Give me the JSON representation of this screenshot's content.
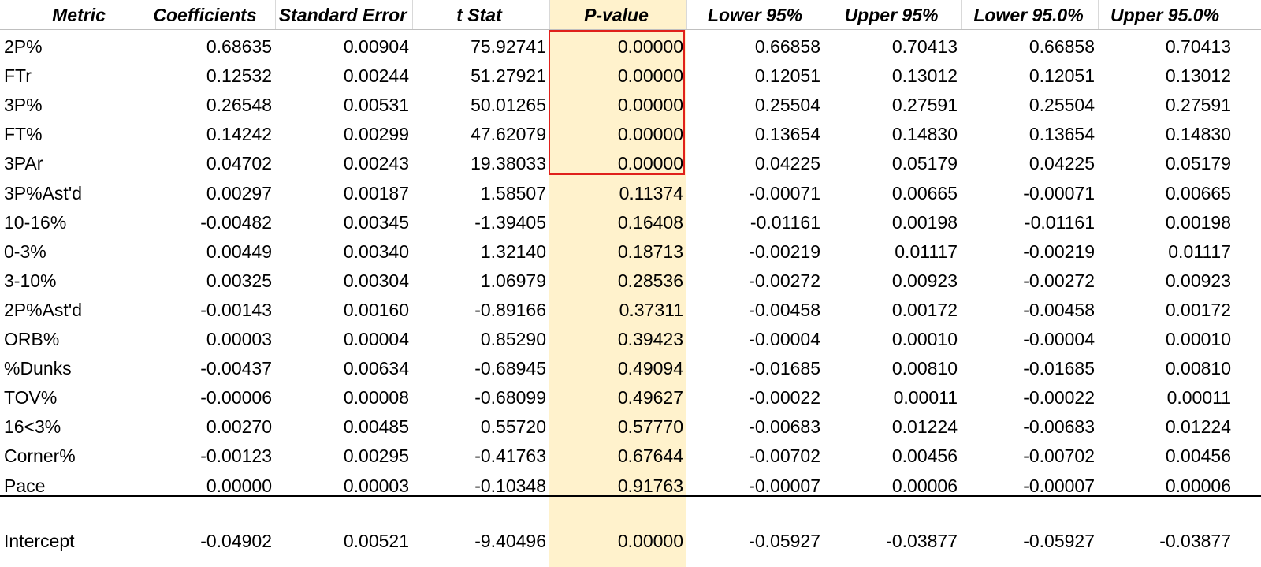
{
  "headers": [
    "Metric",
    "Coefficients",
    "Standard Error",
    "t Stat",
    "P-value",
    "Lower 95%",
    "Upper 95%",
    "Lower 95.0%",
    "Upper 95.0%"
  ],
  "rows": [
    [
      "2P%",
      "0.68635",
      "0.00904",
      "75.92741",
      "0.00000",
      "0.66858",
      "0.70413",
      "0.66858",
      "0.70413"
    ],
    [
      "FTr",
      "0.12532",
      "0.00244",
      "51.27921",
      "0.00000",
      "0.12051",
      "0.13012",
      "0.12051",
      "0.13012"
    ],
    [
      "3P%",
      "0.26548",
      "0.00531",
      "50.01265",
      "0.00000",
      "0.25504",
      "0.27591",
      "0.25504",
      "0.27591"
    ],
    [
      "FT%",
      "0.14242",
      "0.00299",
      "47.62079",
      "0.00000",
      "0.13654",
      "0.14830",
      "0.13654",
      "0.14830"
    ],
    [
      "3PAr",
      "0.04702",
      "0.00243",
      "19.38033",
      "0.00000",
      "0.04225",
      "0.05179",
      "0.04225",
      "0.05179"
    ],
    [
      "3P%Ast'd",
      "0.00297",
      "0.00187",
      "1.58507",
      "0.11374",
      "-0.00071",
      "0.00665",
      "-0.00071",
      "0.00665"
    ],
    [
      "10-16%",
      "-0.00482",
      "0.00345",
      "-1.39405",
      "0.16408",
      "-0.01161",
      "0.00198",
      "-0.01161",
      "0.00198"
    ],
    [
      "0-3%",
      "0.00449",
      "0.00340",
      "1.32140",
      "0.18713",
      "-0.00219",
      "0.01117",
      "-0.00219",
      "0.01117"
    ],
    [
      "3-10%",
      "0.00325",
      "0.00304",
      "1.06979",
      "0.28536",
      "-0.00272",
      "0.00923",
      "-0.00272",
      "0.00923"
    ],
    [
      "2P%Ast'd",
      "-0.00143",
      "0.00160",
      "-0.89166",
      "0.37311",
      "-0.00458",
      "0.00172",
      "-0.00458",
      "0.00172"
    ],
    [
      "ORB%",
      "0.00003",
      "0.00004",
      "0.85290",
      "0.39423",
      "-0.00004",
      "0.00010",
      "-0.00004",
      "0.00010"
    ],
    [
      "%Dunks",
      "-0.00437",
      "0.00634",
      "-0.68945",
      "0.49094",
      "-0.01685",
      "0.00810",
      "-0.01685",
      "0.00810"
    ],
    [
      "TOV%",
      "-0.00006",
      "0.00008",
      "-0.68099",
      "0.49627",
      "-0.00022",
      "0.00011",
      "-0.00022",
      "0.00011"
    ],
    [
      "16<3%",
      "0.00270",
      "0.00485",
      "0.55720",
      "0.57770",
      "-0.00683",
      "0.01224",
      "-0.00683",
      "0.01224"
    ],
    [
      "Corner%",
      "-0.00123",
      "0.00295",
      "-0.41763",
      "0.67644",
      "-0.00702",
      "0.00456",
      "-0.00702",
      "0.00456"
    ],
    [
      "Pace",
      "0.00000",
      "0.00003",
      "-0.10348",
      "0.91763",
      "-0.00007",
      "0.00006",
      "-0.00007",
      "0.00006"
    ]
  ],
  "intercept": [
    "Intercept",
    "-0.04902",
    "0.00521",
    "-9.40496",
    "0.00000",
    "-0.05927",
    "-0.03877",
    "-0.05927",
    "-0.03877"
  ],
  "style": {
    "pvalue_column_fill": "#fff2cc",
    "highlight_border": "#e0201b"
  }
}
